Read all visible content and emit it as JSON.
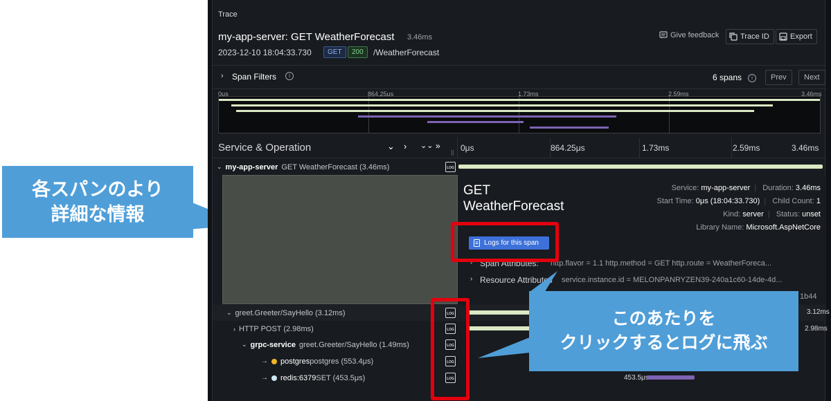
{
  "trace": {
    "section_title": "Trace",
    "title": "my-app-server: GET WeatherForecast",
    "duration": "3.46ms",
    "timestamp": "2023-12-10 18:04:33.730",
    "method": "GET",
    "status_code": "200",
    "path": "/WeatherForecast",
    "give_feedback": "Give feedback",
    "trace_id_label": "Trace ID",
    "export_label": "Export"
  },
  "filters": {
    "label": "Span Filters",
    "span_count": "6 spans",
    "prev_label": "Prev",
    "next_label": "Next"
  },
  "minimap": {
    "ticks": [
      "0μs",
      "864.25μs",
      "1.73ms",
      "2.59ms",
      "3.46ms"
    ]
  },
  "timeline": {
    "column_title": "Service & Operation",
    "ticks": [
      "0μs",
      "864.25μs",
      "1.73ms",
      "2.59ms",
      "3.46ms"
    ]
  },
  "spans": [
    {
      "service": "my-app-server",
      "operation": "GET WeatherForecast (3.46ms)",
      "start": 0.0,
      "duration_ms": 3.46
    },
    {
      "service": "",
      "operation": "greet.Greeter/SayHello (3.12ms)",
      "label": "3.12ms",
      "start": 0.07,
      "duration_ms": 3.12
    },
    {
      "service": "",
      "operation": "HTTP POST (2.98ms)",
      "label": "2.98ms",
      "start": 0.1,
      "duration_ms": 2.98
    },
    {
      "service": "grpc-service",
      "operation": "greet.Greeter/SayHello (1.49ms)",
      "start": 0.8,
      "duration_ms": 1.49
    },
    {
      "service": "postgres",
      "operation": "postgres (553.4μs)",
      "start": 1.2,
      "duration_ms": 0.5534
    },
    {
      "service": "redis:6379",
      "operation": "SET (453.5μs)",
      "label": "453.5μs",
      "start": 1.79,
      "duration_ms": 0.4535
    }
  ],
  "detail": {
    "title_line1": "GET",
    "title_line2": "WeatherForecast",
    "service_key": "Service:",
    "service_val": "my-app-server",
    "duration_key": "Duration:",
    "duration_val": "3.46ms",
    "start_key": "Start Time:",
    "start_val": "0μs (18:04:33.730)",
    "child_key": "Child Count:",
    "child_val": "1",
    "kind_key": "Kind:",
    "kind_val": "server",
    "status_key": "Status:",
    "status_val": "unset",
    "library_key": "Library Name:",
    "library_val": "Microsoft.AspNetCore",
    "logs_button": "Logs for this span",
    "span_attr_label": "Span Attributes:",
    "span_attr_values": "http.flavor = 1.1   http.method = GET   http.route = WeatherForeca...",
    "resource_attr_label": "Resource Attributes",
    "resource_attr_values": "service.instance.id = MELONPANRYZEN39-240a1c60-14de-4d...",
    "resource_attr_tail": "1b44"
  },
  "callouts": {
    "left_line1": "各スパンのより",
    "left_line2": "詳細な情報",
    "right_line1": "このあたりを",
    "right_line2": "クリックするとログに飛ぶ"
  },
  "colors": {
    "server_bar": "#dbe8c4",
    "db_bar": "#7d63b3",
    "annotation_red": "#e3000f",
    "callout_blue": "#4f9ed8",
    "logs_button": "#3d71d9"
  }
}
